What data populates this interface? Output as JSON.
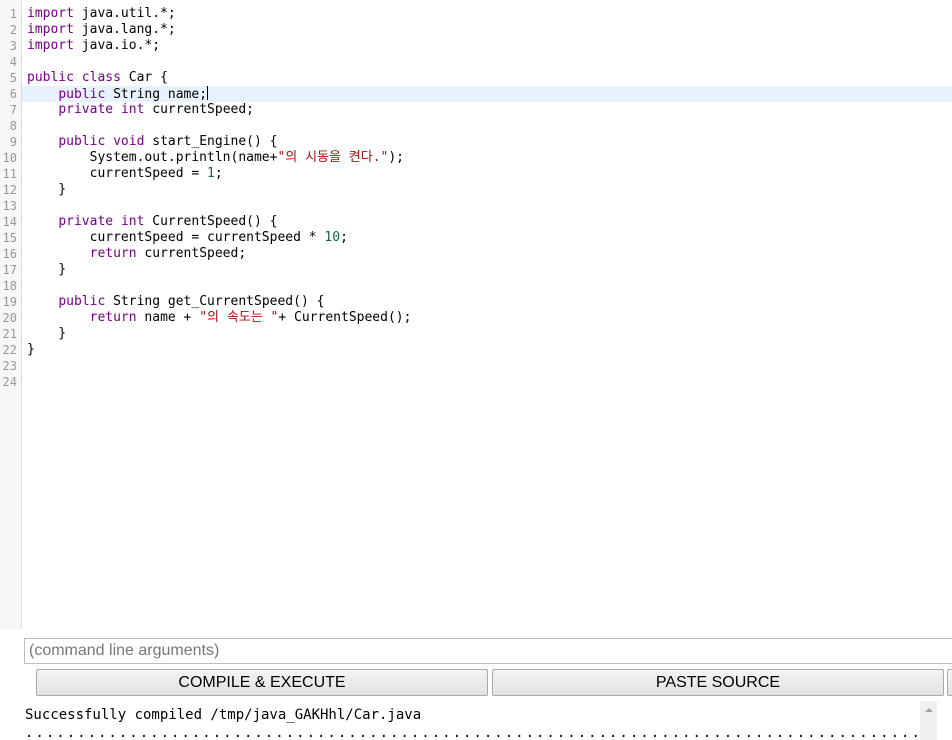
{
  "editor": {
    "line_numbers": [
      "1",
      "2",
      "3",
      "4",
      "5",
      "6",
      "7",
      "8",
      "9",
      "10",
      "11",
      "12",
      "13",
      "14",
      "15",
      "16",
      "17",
      "18",
      "19",
      "20",
      "21",
      "22",
      "23",
      "24"
    ],
    "active_line": 6,
    "lines": [
      [
        {
          "t": "import",
          "c": "kw"
        },
        {
          "t": " java.util.*;",
          "c": ""
        }
      ],
      [
        {
          "t": "import",
          "c": "kw"
        },
        {
          "t": " java.lang.*;",
          "c": ""
        }
      ],
      [
        {
          "t": "import",
          "c": "kw"
        },
        {
          "t": " java.io.*;",
          "c": ""
        }
      ],
      [],
      [
        {
          "t": "public",
          "c": "kw"
        },
        {
          "t": " ",
          "c": ""
        },
        {
          "t": "class",
          "c": "kw"
        },
        {
          "t": " Car {",
          "c": ""
        }
      ],
      [
        {
          "t": "    ",
          "c": ""
        },
        {
          "t": "public",
          "c": "kw"
        },
        {
          "t": " String name;",
          "c": ""
        }
      ],
      [
        {
          "t": "    ",
          "c": ""
        },
        {
          "t": "private",
          "c": "kw"
        },
        {
          "t": " ",
          "c": ""
        },
        {
          "t": "int",
          "c": "kw"
        },
        {
          "t": " currentSpeed;",
          "c": ""
        }
      ],
      [],
      [
        {
          "t": "    ",
          "c": ""
        },
        {
          "t": "public",
          "c": "kw"
        },
        {
          "t": " ",
          "c": ""
        },
        {
          "t": "void",
          "c": "kw"
        },
        {
          "t": " start_Engine() {",
          "c": ""
        }
      ],
      [
        {
          "t": "        System.out.println(name+",
          "c": ""
        },
        {
          "t": "\"의 시동을 켠다.\"",
          "c": "str"
        },
        {
          "t": ");",
          "c": ""
        }
      ],
      [
        {
          "t": "        currentSpeed = ",
          "c": ""
        },
        {
          "t": "1",
          "c": "num"
        },
        {
          "t": ";",
          "c": ""
        }
      ],
      [
        {
          "t": "    }",
          "c": ""
        }
      ],
      [],
      [
        {
          "t": "    ",
          "c": ""
        },
        {
          "t": "private",
          "c": "kw"
        },
        {
          "t": " ",
          "c": ""
        },
        {
          "t": "int",
          "c": "kw"
        },
        {
          "t": " CurrentSpeed() {",
          "c": ""
        }
      ],
      [
        {
          "t": "        currentSpeed = currentSpeed * ",
          "c": ""
        },
        {
          "t": "10",
          "c": "num"
        },
        {
          "t": ";",
          "c": ""
        }
      ],
      [
        {
          "t": "        ",
          "c": ""
        },
        {
          "t": "return",
          "c": "kw"
        },
        {
          "t": " currentSpeed;",
          "c": ""
        }
      ],
      [
        {
          "t": "    }",
          "c": ""
        }
      ],
      [],
      [
        {
          "t": "    ",
          "c": ""
        },
        {
          "t": "public",
          "c": "kw"
        },
        {
          "t": " String get_CurrentSpeed() {",
          "c": ""
        }
      ],
      [
        {
          "t": "        ",
          "c": ""
        },
        {
          "t": "return",
          "c": "kw"
        },
        {
          "t": " name + ",
          "c": ""
        },
        {
          "t": "\"의 속도는 \"",
          "c": "str"
        },
        {
          "t": "+ CurrentSpeed();",
          "c": ""
        }
      ],
      [
        {
          "t": "    }",
          "c": ""
        }
      ],
      [
        {
          "t": "}",
          "c": ""
        }
      ],
      [],
      []
    ],
    "colors": {
      "keyword": "#770088",
      "string": "#aa1111",
      "number": "#116644",
      "active_line_bg": "#e8f2fe"
    }
  },
  "args": {
    "placeholder": "(command line arguments)",
    "value": ""
  },
  "buttons": {
    "compile_label": "COMPILE & EXECUTE",
    "paste_label": "PASTE SOURCE"
  },
  "output": {
    "lines": [
      "Successfully compiled /tmp/java_GAKHhl/Car.java"
    ],
    "dots": "......................................................................................"
  }
}
